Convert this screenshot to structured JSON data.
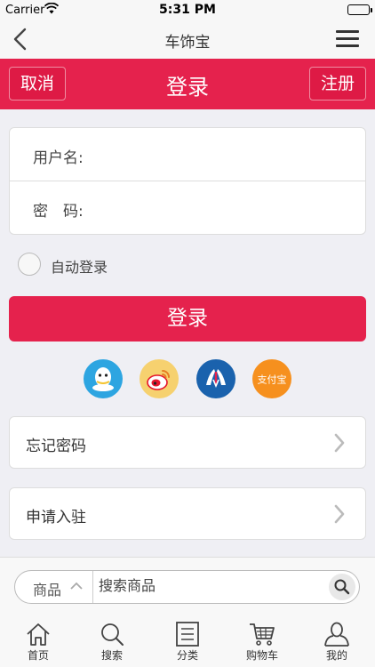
{
  "status": {
    "carrier": "Carrier",
    "time": "5:31 PM"
  },
  "nav": {
    "title": "车饰宝"
  },
  "header": {
    "cancel": "取消",
    "title": "登录",
    "register": "注册"
  },
  "form": {
    "username_label": "用户名:",
    "password_label": "密　码:"
  },
  "auto_login": {
    "label": "自动登录",
    "checked": false
  },
  "login_button": "登录",
  "social": [
    {
      "name": "qq",
      "color": "#2da5e1"
    },
    {
      "name": "weibo",
      "color": "#f6d16f"
    },
    {
      "name": "renren",
      "color": "#1a62ad"
    },
    {
      "name": "alipay",
      "color": "#f6901e",
      "text": "支付宝"
    }
  ],
  "links": {
    "forgot": "忘记密码",
    "apply": "申请入驻"
  },
  "search": {
    "category": "商品",
    "placeholder": "搜索商品"
  },
  "tabs": {
    "home": "首页",
    "search": "搜索",
    "category": "分类",
    "cart": "购物车",
    "mine": "我的"
  },
  "colors": {
    "accent": "#e5224d",
    "background": "#efeff4"
  }
}
